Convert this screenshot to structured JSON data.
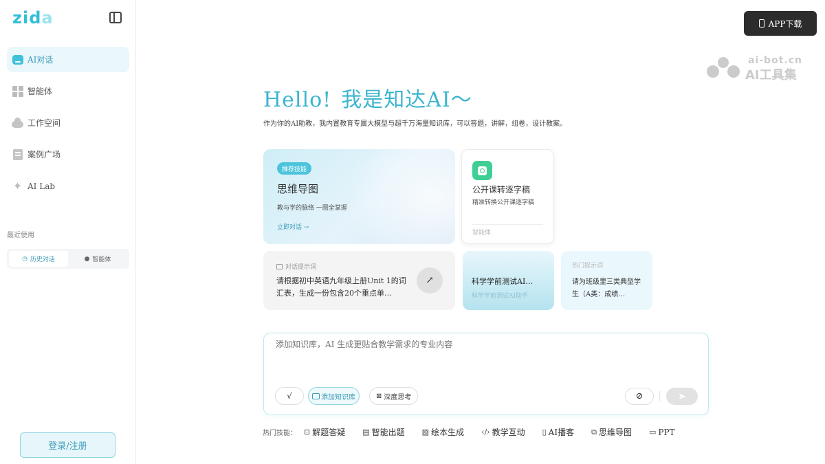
{
  "sidebar": {
    "logo": {
      "main": "zid",
      "accent": "a"
    },
    "nav": [
      {
        "label": "AI对话",
        "icon": "chat-icon",
        "active": true
      },
      {
        "label": "智能体",
        "icon": "grid-icon"
      },
      {
        "label": "工作空间",
        "icon": "cloud-icon"
      },
      {
        "label": "案例广场",
        "icon": "document-icon"
      },
      {
        "label": "AI Lab",
        "icon": "sparkle-icon"
      }
    ],
    "recent_title": "最近使用",
    "recent_tabs": [
      {
        "label": "历史对话",
        "icon": "history-icon",
        "active": true
      },
      {
        "label": "智能体",
        "icon": "bot-icon"
      }
    ],
    "login_label": "登录/注册"
  },
  "header": {
    "app_download": "APP下载",
    "watermark": {
      "line1": "ai-bot.cn",
      "line2": "AI工具集"
    }
  },
  "main": {
    "hello": "Hello!",
    "hello_zh": "我是知达AI～",
    "subtitle": "作为你的AI助教，我内置教育专属大模型与超千万海量知识库，可以答题，讲解，组卷，设计教案。",
    "cards": {
      "mind": {
        "badge": "推荐技能",
        "title": "思维导图",
        "desc": "教与学的脉络 一图全掌握",
        "link": "立即对话 →"
      },
      "transcript": {
        "title": "公开课转逐字稿",
        "desc": "精准转换公开课逐字稿",
        "tag": "智能体"
      },
      "prompt": {
        "label": "对话提示词",
        "text": "请根据初中英语九年级上册Unit 1的词汇表，生成一份包含20个重点单…",
        "arrow": "↗"
      },
      "science": {
        "title": "科学学前测试AI…",
        "desc": "科学学前测试AI助手"
      },
      "hot_prompt": {
        "label": "热门提示词",
        "text": "请为班级里三类典型学生（A类：成绩…"
      }
    },
    "input": {
      "placeholder": "添加知识库，AI 生成更贴合教学需求的专业内容",
      "check_label": "√",
      "kb_label": "添加知识库",
      "deep_label": "深度思考"
    },
    "hot_skills": {
      "label": "热门技能：",
      "items": [
        {
          "label": "解题答疑",
          "icon": "qa-icon"
        },
        {
          "label": "智能出题",
          "icon": "exam-icon"
        },
        {
          "label": "绘本生成",
          "icon": "picture-icon"
        },
        {
          "label": "教学互动",
          "icon": "code-icon"
        },
        {
          "label": "AI播客",
          "icon": "mic-icon"
        },
        {
          "label": "思维导图",
          "icon": "mindmap-icon"
        },
        {
          "label": "PPT",
          "icon": "ppt-icon"
        }
      ]
    }
  },
  "colors": {
    "accent": "#3bb5cf",
    "brand_dark": "#2c2c2c",
    "green": "#3fcf95"
  }
}
